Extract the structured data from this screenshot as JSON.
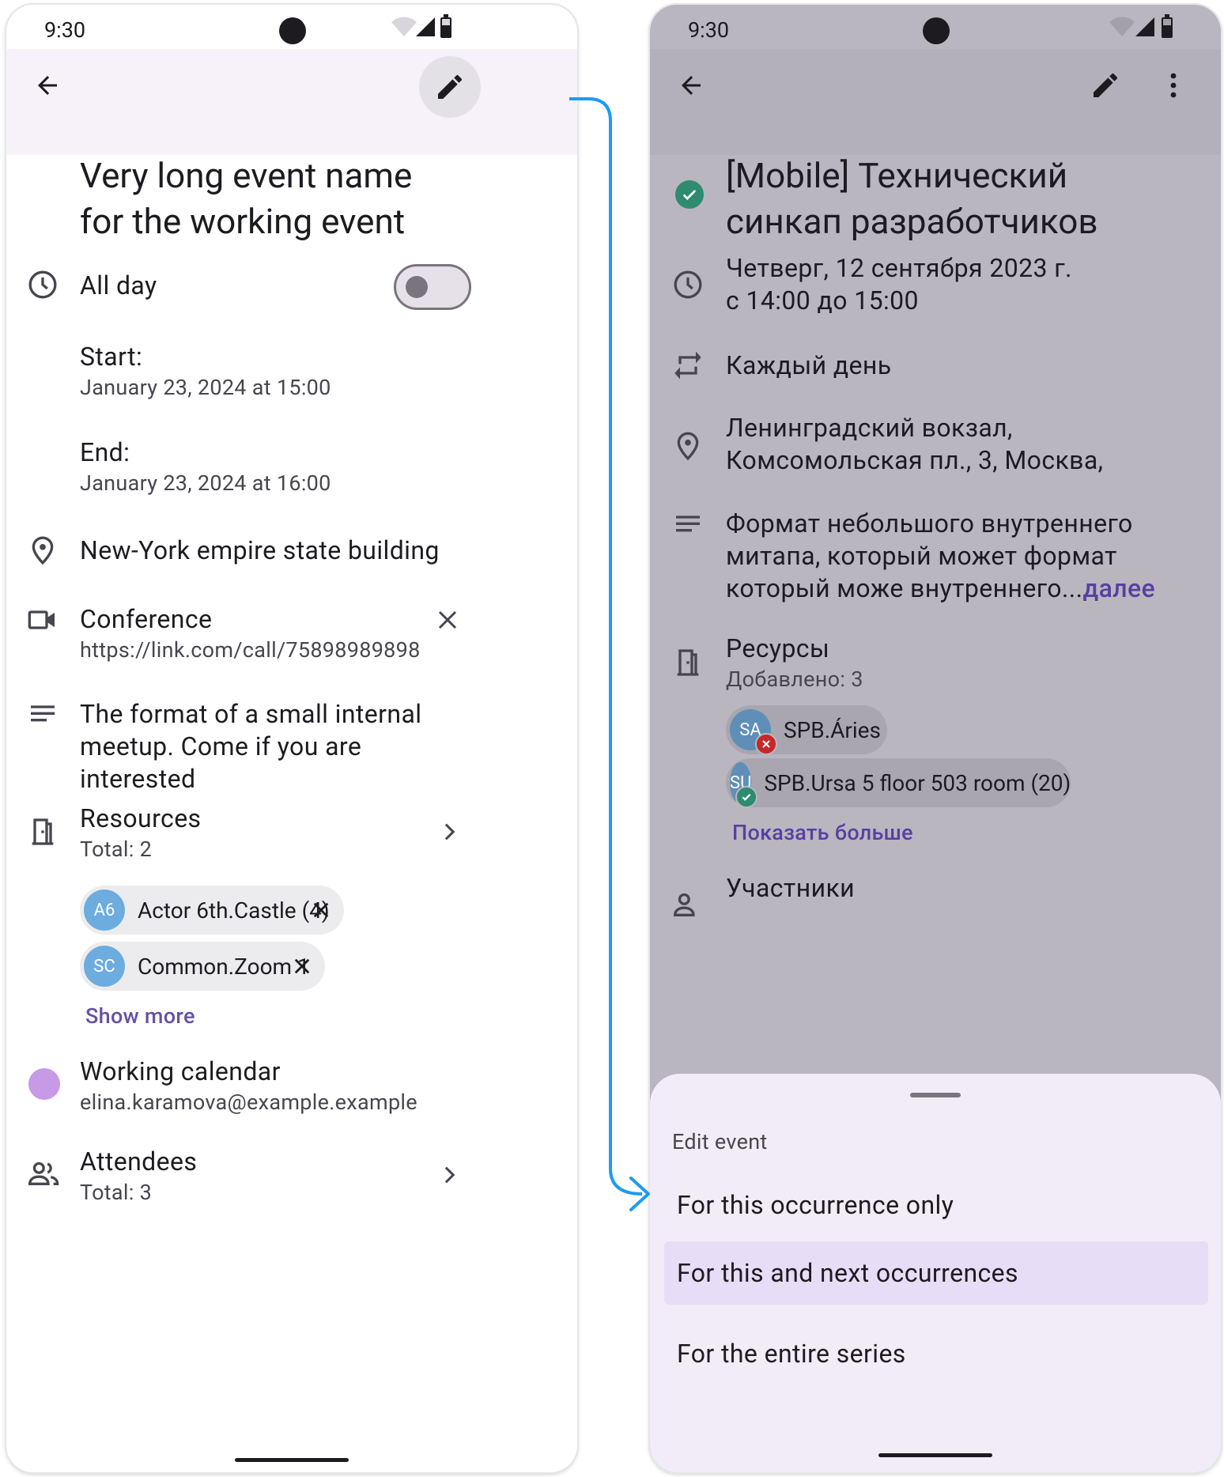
{
  "left": {
    "status_time": "9:30",
    "event_title": "Very long event name for the working event",
    "allday_label": "All day",
    "start_label": "Start:",
    "start_value": "January 23, 2024 at 15:00",
    "end_label": "End:",
    "end_value": "January 23, 2024 at 16:00",
    "location": "New-York empire state building",
    "conference_label": "Conference",
    "conference_link": "https://link.com/call/75898989898",
    "description": "The format of a small internal meetup. Come if you are interested",
    "resources_label": "Resources",
    "resources_total": "Total: 2",
    "resources": [
      {
        "initials": "A6",
        "name": "Actor 6th.Castle (4)"
      },
      {
        "initials": "SC",
        "name": "Common.Zoom 1"
      }
    ],
    "show_more": "Show more",
    "calendar_name": "Working calendar",
    "calendar_email": "elina.karamova@example.example",
    "calendar_color": "#c79ae8",
    "attendees_label": "Attendees",
    "attendees_total": "Total: 3"
  },
  "right": {
    "status_time": "9:30",
    "event_title_line1": "[Mobile] Технический",
    "event_title_line2": "синкап разработчиков",
    "date_line1": "Четверг, 12 сентября 2023 г.",
    "date_line2": "с 14:00 до 15:00",
    "repeat": "Каждый день",
    "location_line1": "Ленинградский вокзал,",
    "location_line2": "Комсомольская пл., 3, Москва,",
    "description_line1": "Формат небольшого внутреннего",
    "description_line2": "митапа, который может формат",
    "description_line3": "который може  внутреннего...",
    "description_more": "далее",
    "resources_label": "Ресурсы",
    "resources_added": "Добавлено: 3",
    "resources": [
      {
        "initials": "SA",
        "name": "SPB.Áries",
        "status": "declined"
      },
      {
        "initials": "SU",
        "name": "SPB.Ursa 5 floor 503 room (20)",
        "status": "accepted"
      }
    ],
    "show_more": "Показать больше",
    "attendees_label": "Участники",
    "sheet": {
      "title": "Edit event",
      "options": [
        "For this occurrence only",
        "For this and next occurrences",
        "For the entire series"
      ],
      "selected_index": 1
    }
  },
  "colors": {
    "accent": "#6750a4",
    "connector": "#1e9bf0",
    "accepted": "#2e8b6f",
    "declined": "#c62828",
    "avatar": "#6cacdf"
  }
}
